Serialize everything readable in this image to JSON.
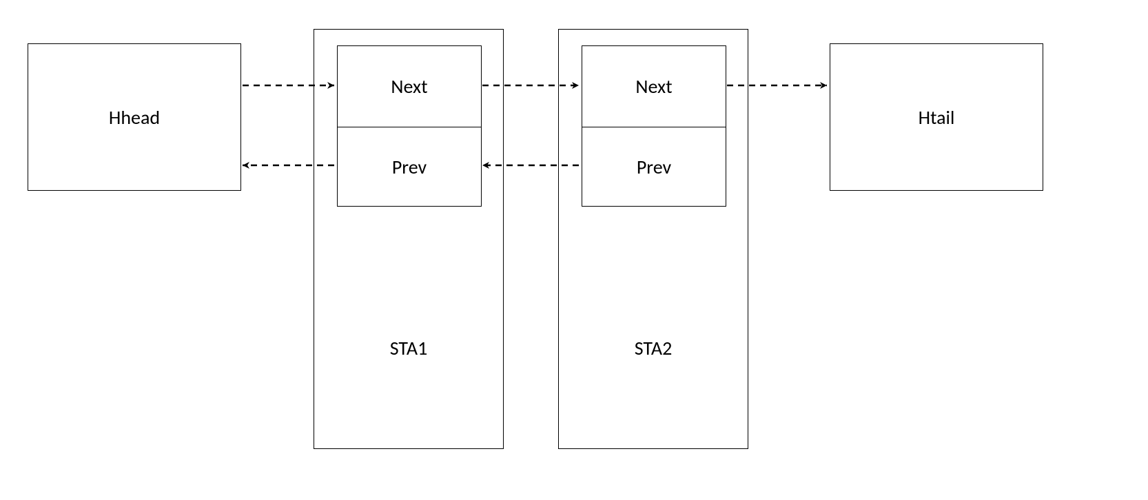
{
  "head": {
    "label": "Hhead"
  },
  "tail": {
    "label": "Htail"
  },
  "nodes": [
    {
      "name": "STA1",
      "next_label": "Next",
      "prev_label": "Prev"
    },
    {
      "name": "STA2",
      "next_label": "Next",
      "prev_label": "Prev"
    }
  ]
}
